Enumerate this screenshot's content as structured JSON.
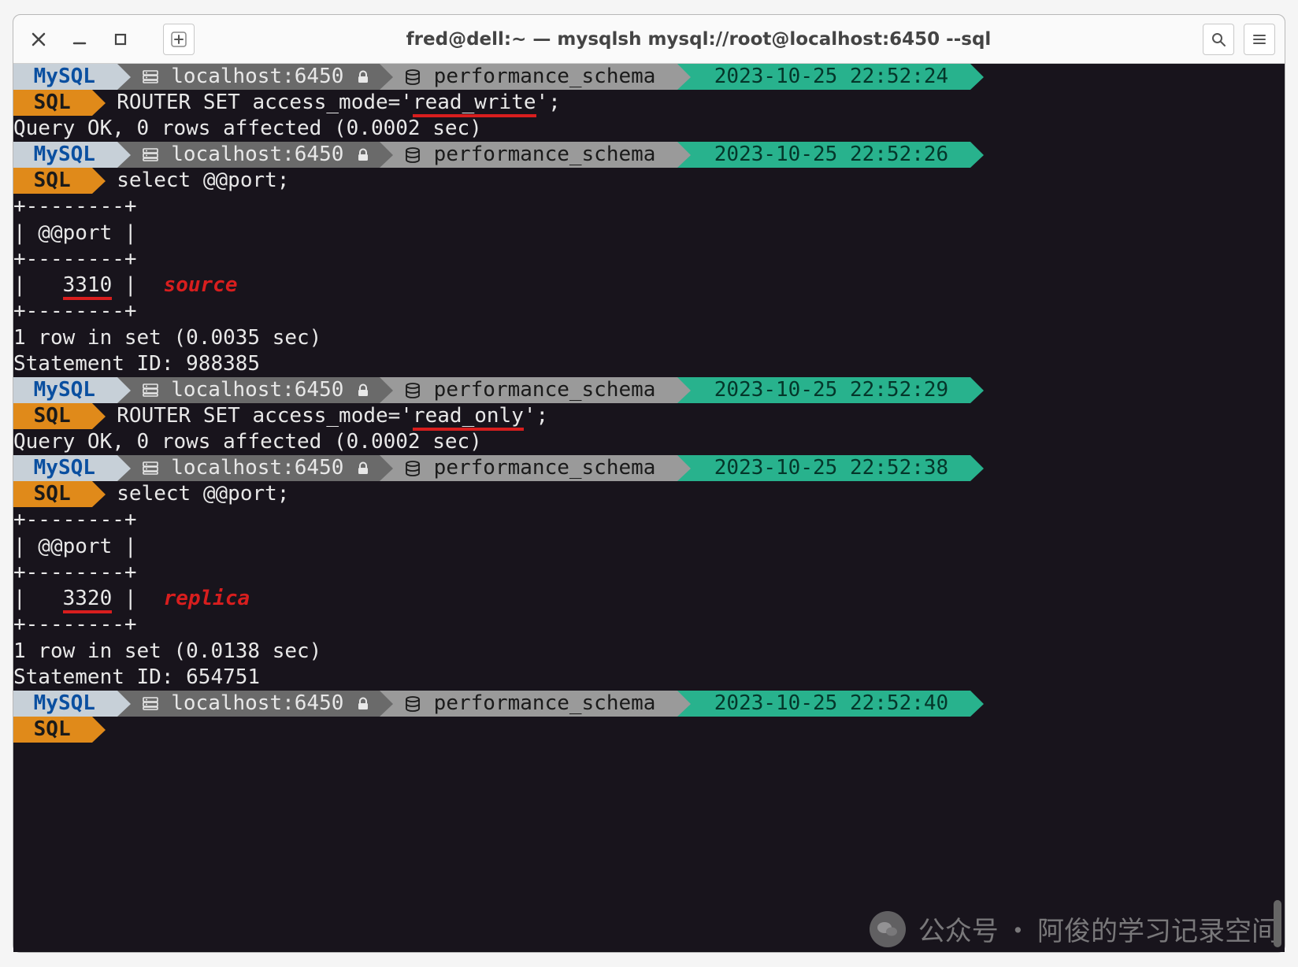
{
  "window": {
    "title": "fred@dell:~ — mysqlsh mysql://root@localhost:6450 --sql"
  },
  "prompt": {
    "mysql": "MySQL",
    "host": "localhost:6450",
    "schema": "performance_schema",
    "sql": "SQL"
  },
  "blocks": [
    {
      "timestamp": "2023-10-25 22:52:24",
      "command": "ROUTER SET access_mode='read_write';",
      "underline_fragment": "read_write",
      "result_lines": [
        "Query OK, 0 rows affected (0.0002 sec)"
      ]
    },
    {
      "timestamp": "2023-10-25 22:52:26",
      "command": "select @@port;",
      "table": {
        "sep": "+--------+",
        "header": "| @@port |",
        "value_row_pre": "|   ",
        "value": "3310",
        "value_row_post": " |",
        "note": "source"
      },
      "after_lines": [
        "1 row in set (0.0035 sec)",
        "Statement ID: 988385"
      ]
    },
    {
      "timestamp": "2023-10-25 22:52:29",
      "command": "ROUTER SET access_mode='read_only';",
      "underline_fragment": "read_only",
      "result_lines": [
        "Query OK, 0 rows affected (0.0002 sec)"
      ]
    },
    {
      "timestamp": "2023-10-25 22:52:38",
      "command": "select @@port;",
      "table": {
        "sep": "+--------+",
        "header": "| @@port |",
        "value_row_pre": "|   ",
        "value": "3320",
        "value_row_post": " |",
        "note": "replica"
      },
      "after_lines": [
        "1 row in set (0.0138 sec)",
        "Statement ID: 654751"
      ]
    },
    {
      "timestamp": "2023-10-25 22:52:40",
      "command": ""
    }
  ],
  "watermark": {
    "text": "公众号 · 阿俊的学习记录空间"
  }
}
